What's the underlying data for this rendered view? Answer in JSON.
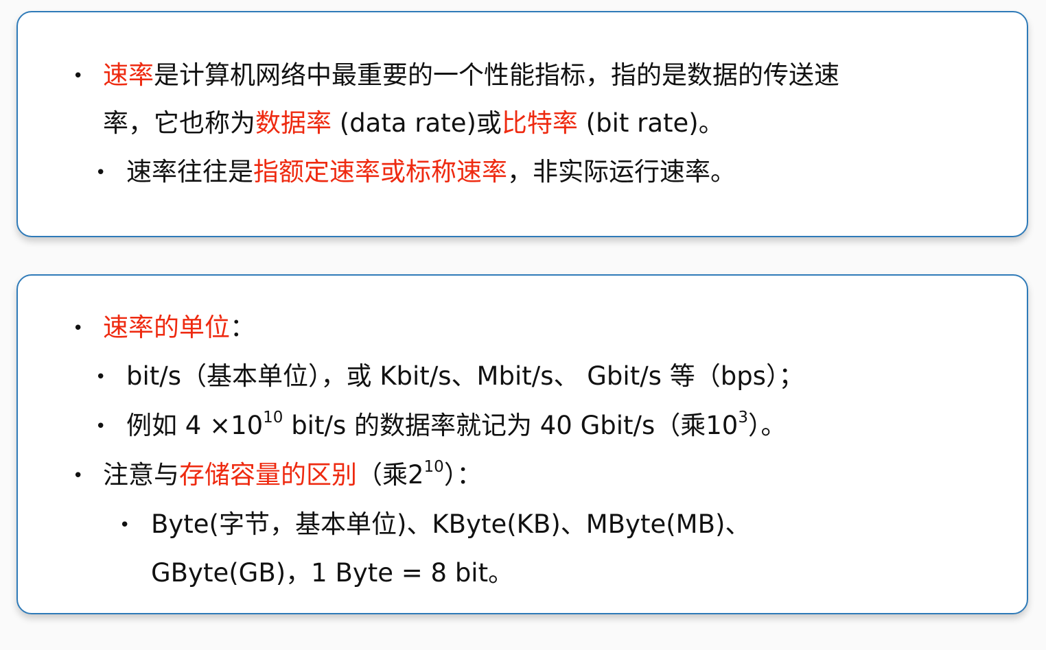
{
  "panel1": {
    "item1": {
      "term": "速率",
      "text_a": "是计算机网络中最重要的一个性能指标，指的是数据的传送速",
      "text_b": "率，它也称为",
      "data_rate": "数据率",
      "data_rate_en": " (data rate)或",
      "bit_rate": "比特率",
      "bit_rate_en": " (bit rate)。"
    },
    "sub1": {
      "text_a": "速率往往是",
      "highlight": "指额定速率或标称速率",
      "text_b": "，非实际运行速率。"
    }
  },
  "panel2": {
    "item1": {
      "term": "速率的单位",
      "colon": "："
    },
    "sub1": {
      "text": "bit/s（基本单位），或 Kbit/s、Mbit/s、 Gbit/s 等（bps）；"
    },
    "sub2": {
      "text_a": "例如 4 ×10",
      "exp_a": "10",
      "text_b": " bit/s 的数据率就记为 40 Gbit/s（乘10",
      "exp_b": "3",
      "text_c": "）。"
    },
    "item2": {
      "text_a": "注意与",
      "highlight": "存储容量的区别",
      "text_b": "（乘2",
      "exp": "10",
      "text_c": "）："
    },
    "sub3": {
      "line1": "Byte(字节，基本单位)、KByte(KB)、MByte(MB)、",
      "line2": "GByte(GB)，1 Byte = 8 bit。"
    }
  },
  "bullet_char": "•",
  "colors": {
    "border": "#2e7ab8",
    "highlight": "#ee2a10",
    "text": "#111111"
  }
}
